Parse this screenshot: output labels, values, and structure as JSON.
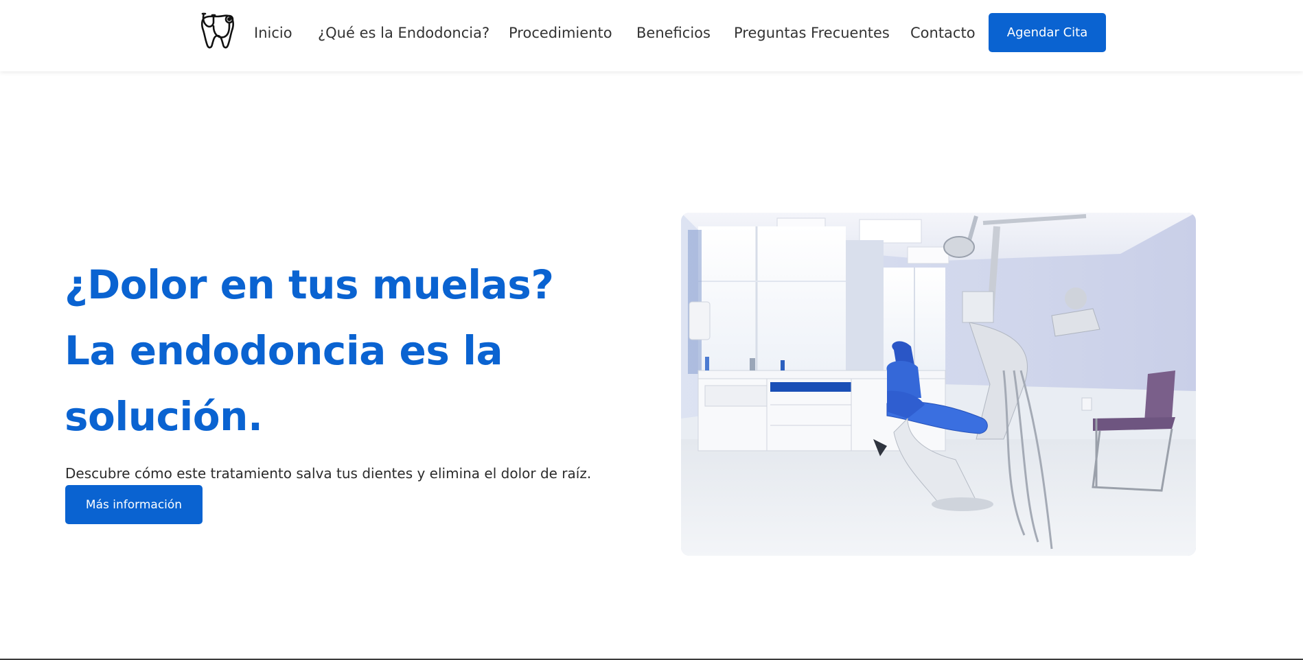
{
  "colors": {
    "brand_blue": "#0a63d1",
    "text_dark": "#2b2b2b",
    "nav_text": "#333333",
    "background": "#ffffff"
  },
  "header": {
    "logo_icon": "tooth-stethoscope-icon",
    "nav": [
      {
        "label": "Inicio"
      },
      {
        "label": "¿Qué es la Endodoncia?"
      },
      {
        "label": "Procedimiento"
      },
      {
        "label": "Beneficios"
      },
      {
        "label": "Preguntas Frecuentes"
      },
      {
        "label": "Contacto"
      }
    ],
    "cta_label": "Agendar Cita"
  },
  "hero": {
    "title": "¿Dolor en tus muelas? La endodoncia es la solución.",
    "subtitle": "Descubre cómo este tratamiento salva tus dientes y elimina el dolor de raíz.",
    "button_label": "Más información"
  }
}
